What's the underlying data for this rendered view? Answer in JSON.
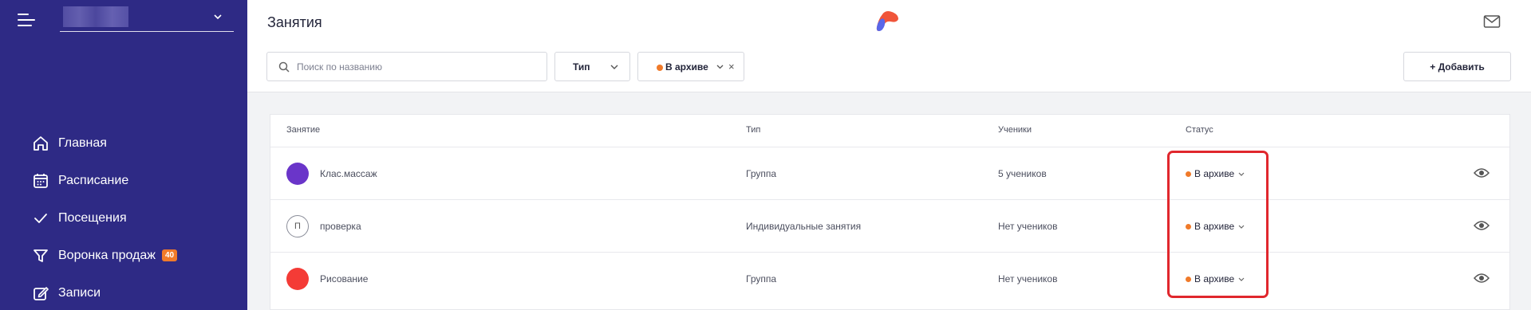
{
  "sidebar": {
    "nav_items": [
      {
        "label": "Главная",
        "icon": "home-icon"
      },
      {
        "label": "Расписание",
        "icon": "calendar-icon"
      },
      {
        "label": "Посещения",
        "icon": "checkmark-icon"
      },
      {
        "label": "Воронка продаж",
        "icon": "funnel-icon",
        "badge": "40"
      },
      {
        "label": "Записи",
        "icon": "edit-icon"
      }
    ]
  },
  "header": {
    "title": "Занятия",
    "search_placeholder": "Поиск по названию",
    "type_filter_label": "Тип",
    "status_filter_label": "В архиве",
    "clear_symbol": "×",
    "add_button_label": "+ Добавить"
  },
  "table": {
    "columns": {
      "name": "Занятие",
      "type": "Тип",
      "students": "Ученики",
      "status": "Статус"
    },
    "rows": [
      {
        "avatar_color": "#6a35c9",
        "avatar_letter": "",
        "name": "Клас.массаж",
        "type": "Группа",
        "students": "5 учеников",
        "status": "В архиве"
      },
      {
        "avatar_color": "#ffffff",
        "avatar_letter": "П",
        "name": "проверка",
        "type": "Индивидуальные занятия",
        "students": "Нет учеников",
        "status": "В архиве"
      },
      {
        "avatar_color": "#f43b36",
        "avatar_letter": "",
        "name": "Рисование",
        "type": "Группа",
        "students": "Нет учеников",
        "status": "В архиве"
      }
    ]
  },
  "colors": {
    "sidebar": "#2e2a85",
    "status_dot": "#f07a2a",
    "highlight": "#e0272d"
  }
}
